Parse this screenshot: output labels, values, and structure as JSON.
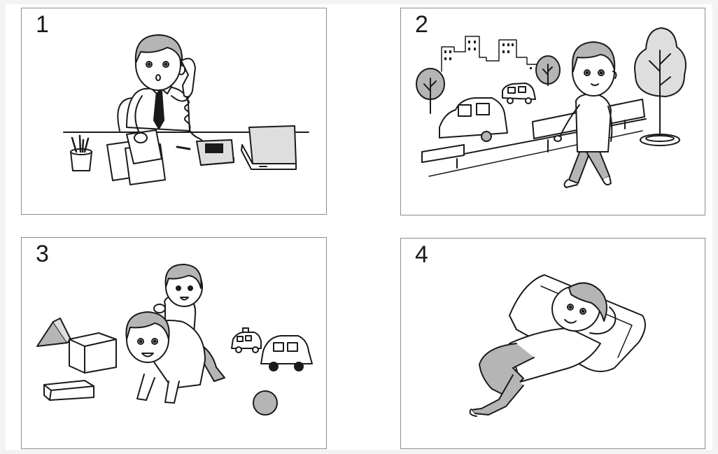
{
  "panels": [
    {
      "number": "1",
      "scene": "office-worker-on-phone"
    },
    {
      "number": "2",
      "scene": "walking-in-city-park"
    },
    {
      "number": "3",
      "scene": "playing-with-child"
    },
    {
      "number": "4",
      "scene": "lying-down-relaxing"
    }
  ],
  "colors": {
    "line": "#1a1a1a",
    "shade": "#b5b5b5",
    "light-shade": "#dedede",
    "frame": "#8c8c8c",
    "page": "#f2f3f5"
  }
}
